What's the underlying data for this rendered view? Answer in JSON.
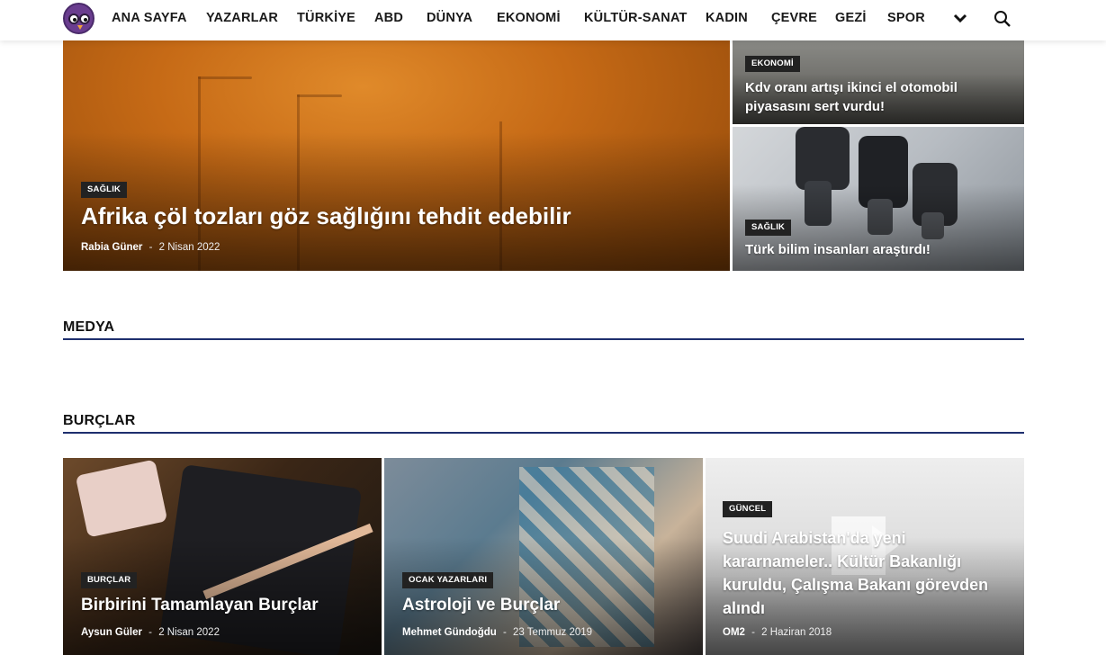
{
  "nav": {
    "items": [
      "ANA SAYFA",
      "YAZARLAR",
      "TÜRKİYE",
      "ABD",
      "DÜNYA",
      "EKONOMİ",
      "KÜLTÜR-SANAT",
      "KADIN",
      "ÇEVRE",
      "GEZİ",
      "SPOR"
    ],
    "more_icon": "chevron-down-icon",
    "search_icon": "search-icon"
  },
  "hero": {
    "badge": "SAĞLIK",
    "title": "Afrika çöl tozları göz sağlığını tehdit edebilir",
    "author": "Rabia Güner",
    "sep": "-",
    "date": "2 Nisan 2022"
  },
  "side_top": {
    "badge": "EKONOMİ",
    "title_line1": "Kdv oranı artışı ikinci el otomobil",
    "title_line2": "piyasasını sert vurdu!"
  },
  "side_bottom": {
    "badge": "SAĞLIK",
    "title": "Türk bilim insanları araştırdı!"
  },
  "sections": {
    "medya": "MEDYA",
    "burclar": "BURÇLAR"
  },
  "cards": [
    {
      "badge": "BURÇLAR",
      "title": "Birbirini Tamamlayan Burçlar",
      "author": "Aysun Güler",
      "sep": "-",
      "date": "2 Nisan 2022"
    },
    {
      "badge": "OCAK YAZARLARI",
      "title": "Astroloji ve Burçlar",
      "author": "Mehmet Gündoğdu",
      "sep": "-",
      "date": "23 Temmuz 2019"
    },
    {
      "badge": "GÜNCEL",
      "title_lines": [
        "Suudi Arabistan'da yeni",
        "kararnameler.. Kültür Bakanlığı",
        "kuruldu, Çalışma Bakanı görevden",
        "alındı"
      ],
      "author": "OM2",
      "sep": "-",
      "date": "2 Haziran 2018"
    }
  ],
  "colors": {
    "accent_line": "#1e2f6e",
    "badge_bg": "#222222"
  }
}
